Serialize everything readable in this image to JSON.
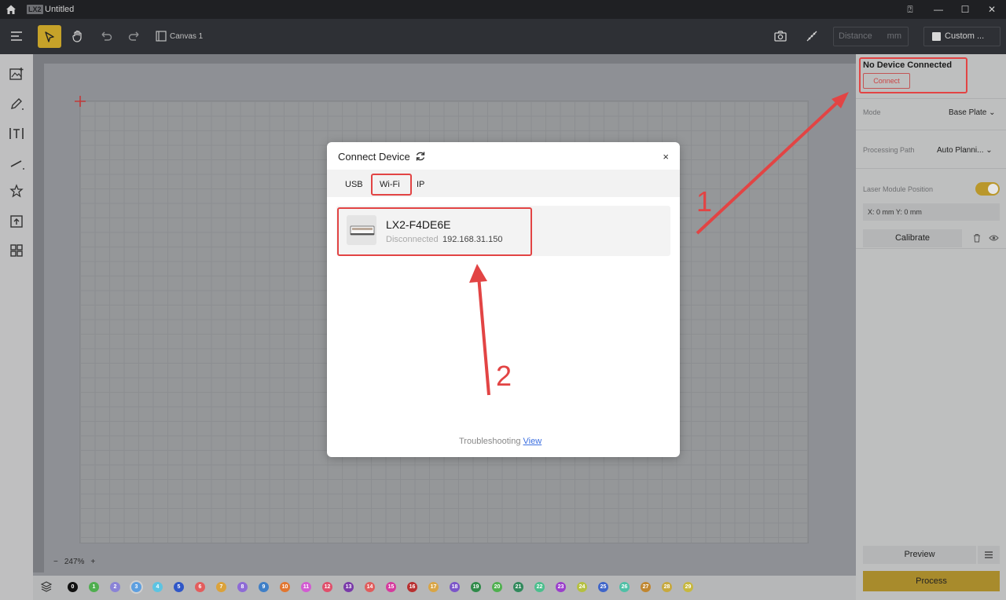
{
  "titlebar": {
    "logo": "LX2",
    "title": "Untitled"
  },
  "toolbar": {
    "canvas_label": "Canvas 1",
    "distance_placeholder": "Distance",
    "distance_unit": "mm",
    "custom_label": "Custom ..."
  },
  "zoom": {
    "minus": "−",
    "level": "247%",
    "plus": "+"
  },
  "layers": [
    "0",
    "1",
    "2",
    "3",
    "4",
    "5",
    "6",
    "7",
    "8",
    "9",
    "10",
    "11",
    "12",
    "13",
    "14",
    "15",
    "16",
    "17",
    "18",
    "19",
    "20",
    "21",
    "22",
    "23",
    "24",
    "25",
    "26",
    "27",
    "28",
    "29"
  ],
  "layer_colors": [
    "#111111",
    "#4fae4f",
    "#8a83d6",
    "#5d9fe0",
    "#5cc4e2",
    "#2f57c8",
    "#e35d5d",
    "#dba23a",
    "#8e6bd6",
    "#3f7fc7",
    "#e2762f",
    "#d25bd2",
    "#e04f6b",
    "#7a3aa9",
    "#e05c5c",
    "#d63b9e",
    "#b83030",
    "#d9a545",
    "#7b55c9",
    "#2f8a49",
    "#4fb04f",
    "#31895c",
    "#4bbf8d",
    "#9b3fcc",
    "#b5c040",
    "#3f65c9",
    "#4fc0a6",
    "#c0862f",
    "#c7a93e",
    "#c7b83e"
  ],
  "right_panel": {
    "status_heading": "No Device Connected",
    "connect_button": "Connect",
    "mode_label": "Mode",
    "mode_value": "Base Plate",
    "processing_path_label": "Processing Path",
    "processing_path_value": "Auto Planni...",
    "laser_module_label": "Laser Module Position",
    "laser_module_on": true,
    "position_readout": "X: 0 mm   Y: 0 mm",
    "calibrate_button": "Calibrate",
    "preview_button": "Preview",
    "process_button": "Process"
  },
  "modal": {
    "title": "Connect Device",
    "close": "×",
    "tabs": [
      "USB",
      "Wi-Fi",
      "IP"
    ],
    "active_tab": "Wi-Fi",
    "device": {
      "name": "LX2-F4DE6E",
      "status": "Disconnected",
      "ip": "192.168.31.150"
    },
    "troubleshooting_text": "Troubleshooting",
    "troubleshooting_link": "View"
  },
  "annotations": {
    "step1": "1",
    "step2": "2"
  },
  "colors": {
    "accent": "#c6a229",
    "annotation": "#e24444"
  }
}
